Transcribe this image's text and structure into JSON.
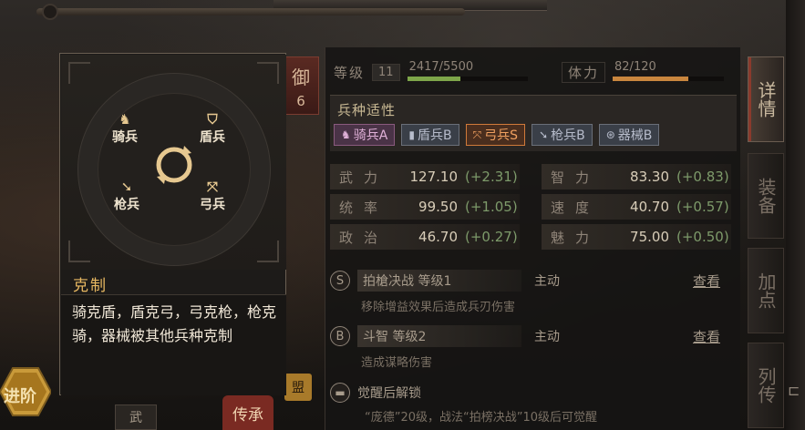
{
  "header": {
    "level_label": "等级",
    "level_value": "11",
    "xp_text": "2417/5500",
    "xp_fraction": 0.44,
    "stamina_label": "体力",
    "stamina_text": "82/120",
    "stamina_fraction": 0.683
  },
  "badge": {
    "char": "御",
    "num": "6"
  },
  "aptitude": {
    "title": "兵种适性",
    "chips": [
      {
        "icon": "cavalry-icon",
        "label": "骑兵A"
      },
      {
        "icon": "shield-icon",
        "label": "盾兵B"
      },
      {
        "icon": "bow-icon",
        "label": "弓兵S"
      },
      {
        "icon": "spear-icon",
        "label": "枪兵B"
      },
      {
        "icon": "siege-icon",
        "label": "器械B"
      }
    ]
  },
  "stats": [
    {
      "name": "武力",
      "value": "127.10",
      "bonus": "(+2.31)"
    },
    {
      "name": "智力",
      "value": "83.30",
      "bonus": "(+0.83)"
    },
    {
      "name": "统率",
      "value": "99.50",
      "bonus": "(+1.05)"
    },
    {
      "name": "速度",
      "value": "40.70",
      "bonus": "(+0.57)"
    },
    {
      "name": "政治",
      "value": "46.70",
      "bonus": "(+0.27)"
    },
    {
      "name": "魅力",
      "value": "75.00",
      "bonus": "(+0.50)"
    }
  ],
  "skills": [
    {
      "grade": "S",
      "name": "拍槍决战 等级1",
      "type": "主动",
      "view": "查看",
      "desc": "移除增益效果后造成兵刃伤害"
    },
    {
      "grade": "B",
      "name": "斗智 等级2",
      "type": "主动",
      "view": "查看",
      "desc": "造成谋略伤害"
    }
  ],
  "awakening": {
    "title": "觉醒后解锁",
    "desc": "“庞德”20级，战法“拍榜决战”10级后可觉醒"
  },
  "side_tabs": [
    {
      "label": "详情",
      "active": true
    },
    {
      "label": "装备",
      "active": false
    },
    {
      "label": "加点",
      "active": false
    },
    {
      "label": "列传",
      "active": false
    }
  ],
  "tooltip": {
    "units": {
      "cavalry": "骑兵",
      "shield": "盾兵",
      "spear": "枪兵",
      "bow": "弓兵"
    },
    "title": "克制",
    "body": "骑克盾，盾克弓，弓克枪，枪克骑，器械被其他兵种克制"
  },
  "bottom": {
    "advance_label": "进阶",
    "wu_label": "武",
    "chuan_label": "传承",
    "meng_label": "盟"
  },
  "colors": {
    "xp_bar": "#7ea64a",
    "stamina_bar": "#c9863e",
    "tooltip_title": "#e9b962",
    "chip_s": "#d07a3a",
    "chip_a": "#8a5a7e"
  }
}
